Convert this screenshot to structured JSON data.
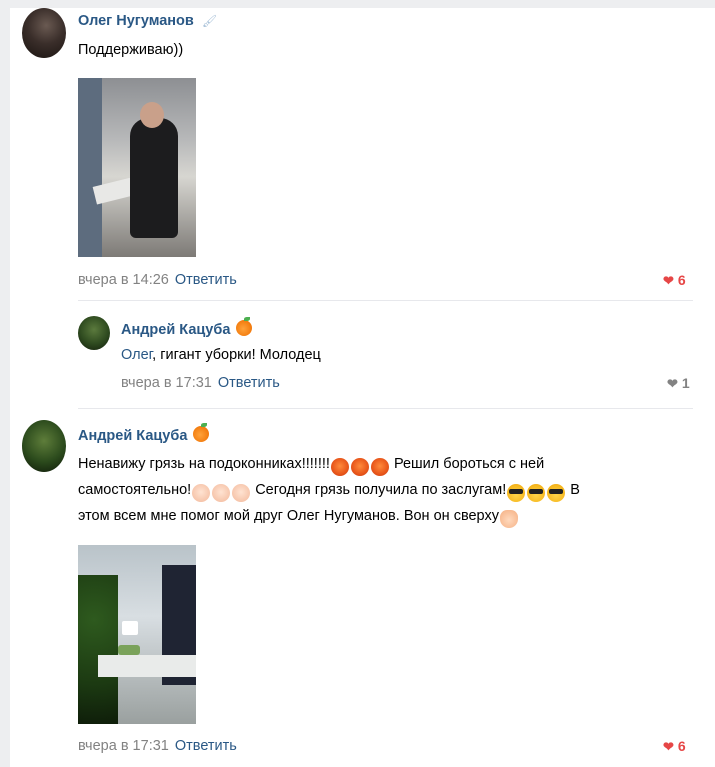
{
  "comments": [
    {
      "author": "Олег Нугуманов",
      "text": "Поддерживаю))",
      "time": "вчера в 14:26",
      "reply_label": "Ответить",
      "likes": "6",
      "liked": true
    },
    {
      "author": "Андрей Кацуба",
      "mention": "Олег",
      "text": ", гигант уборки! Молодец",
      "time": "вчера в 17:31",
      "reply_label": "Ответить",
      "likes": "1",
      "liked": false
    },
    {
      "author": "Андрей Кацуба",
      "text_line1": "Ненавижу грязь на подоконниках!!!!!!!",
      "text_line1b": " Решил бороться с ней",
      "text_line2a": "самостоятельно!",
      "text_line2b": " Сегодня грязь получила по заслугам!",
      "text_line2c": " В",
      "text_line3": "этом всем мне помог мой друг Олег Нугуманов. Вон он сверху",
      "time": "вчера в 17:31",
      "reply_label": "Ответить",
      "likes": "6",
      "liked": true
    }
  ],
  "colors": {
    "link": "#2a5885",
    "like_active": "#e64646",
    "meta": "#828282"
  },
  "icons": [
    "heart-icon",
    "tangerine-badge-icon",
    "feather-badge-icon"
  ]
}
